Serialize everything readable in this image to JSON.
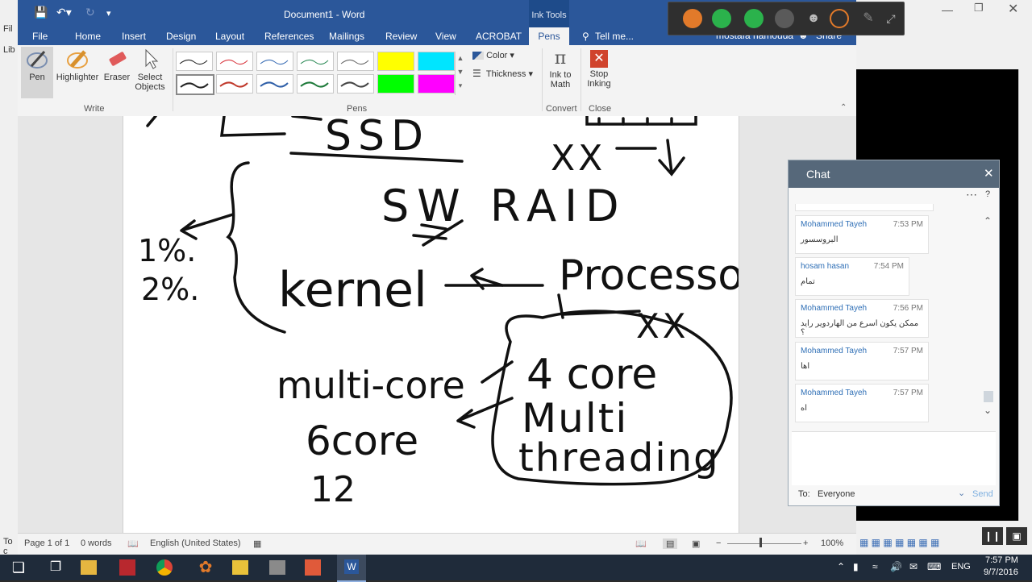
{
  "background": {
    "left_labels": [
      "Fil",
      "Lib",
      "To c"
    ]
  },
  "word": {
    "title": "Document1 - Word",
    "context_tab_group": "Ink Tools",
    "user_name": "mostafa hamouda",
    "share_label": "Share",
    "tabs": [
      "File",
      "Home",
      "Insert",
      "Design",
      "Layout",
      "References",
      "Mailings",
      "Review",
      "View",
      "ACROBAT",
      "Pens"
    ],
    "tell_me": "Tell me...",
    "ribbon": {
      "write_group": {
        "label": "Write",
        "pen": "Pen",
        "highlighter": "Highlighter",
        "eraser": "Eraser",
        "select_objects_1": "Select",
        "select_objects_2": "Objects"
      },
      "pens_group": {
        "label": "Pens"
      },
      "format": {
        "color": "Color",
        "thickness": "Thickness"
      },
      "convert_group": {
        "label": "Convert",
        "ink_to_math_1": "Ink to",
        "ink_to_math_2": "Math"
      },
      "close_group": {
        "label": "Close",
        "stop_inking_1": "Stop",
        "stop_inking_2": "Inking"
      }
    },
    "pen_colors": [
      "#222222",
      "#d9363e",
      "#3a6db5",
      "#2e8b57",
      "#555555",
      "#ffff00",
      "#00e5ff",
      "#222222",
      "#c0392b",
      "#2f5fa8",
      "#1e7a3a",
      "#444444",
      "#00ff00",
      "#ff00ff"
    ],
    "status": {
      "page": "Page 1 of 1",
      "words": "0 words",
      "language": "English (United States)",
      "zoom": "100%"
    }
  },
  "ink_text": {
    "ssd": "SSD",
    "xx_top": "XX",
    "sw_raid": "SW RAID",
    "one_percent": "1%.",
    "two_percent": "2%.",
    "kernel": "kernel",
    "processor": "Processor",
    "xx_mid": "XX",
    "four_core": "4 core",
    "multi": "Multi",
    "threading": "threading",
    "multi_core": "multi-core",
    "six_core": "6core",
    "twelve": "12"
  },
  "chat": {
    "title": "Chat",
    "messages": [
      {
        "name": "Mohammed Tayeh",
        "time": "7:53 PM",
        "text": "البروسسور"
      },
      {
        "name": "hosam hasan",
        "time": "7:54 PM",
        "text": "تمام"
      },
      {
        "name": "Mohammed Tayeh",
        "time": "7:56 PM",
        "text": "ممكن يكون اسرع من الهاردوير رايد ؟"
      },
      {
        "name": "Mohammed Tayeh",
        "time": "7:57 PM",
        "text": "اها"
      },
      {
        "name": "Mohammed Tayeh",
        "time": "7:57 PM",
        "text": "اه"
      }
    ],
    "to_label": "To:",
    "to_value": "Everyone",
    "send_label": "Send"
  },
  "taskbar": {
    "language": "ENG",
    "time": "7:57 PM",
    "date": "9/7/2016"
  },
  "colors": {
    "word_blue": "#2b579a",
    "chat_header": "#56687a",
    "taskbar": "#1f2b3a"
  }
}
